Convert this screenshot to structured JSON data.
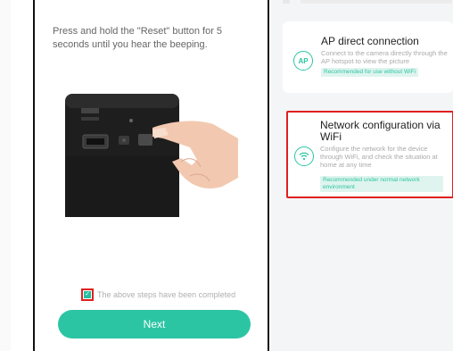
{
  "instruction": {
    "text": "Press and hold the \"Reset\" button for 5 seconds until you hear the beeping."
  },
  "confirm": {
    "checked": true,
    "label": "The above steps have been completed"
  },
  "next_button": {
    "label": "Next"
  },
  "connection_options": [
    {
      "title": "AP direct connection",
      "description": "Connect to the camera directly through the AP hotspot to view the picture",
      "tag": "Recommended for use without WiFi",
      "icon": "ap-icon",
      "icon_text": "AP"
    },
    {
      "title": "Network configuration via WiFi",
      "description": "Configure the network for the device through WiFi, and check the situation at home at any time",
      "tag": "Recommended under normal network environment",
      "icon": "wifi-icon"
    }
  ],
  "colors": {
    "accent": "#2bc5a4",
    "highlight": "#e02020",
    "tag_bg": "#dff4ee"
  }
}
